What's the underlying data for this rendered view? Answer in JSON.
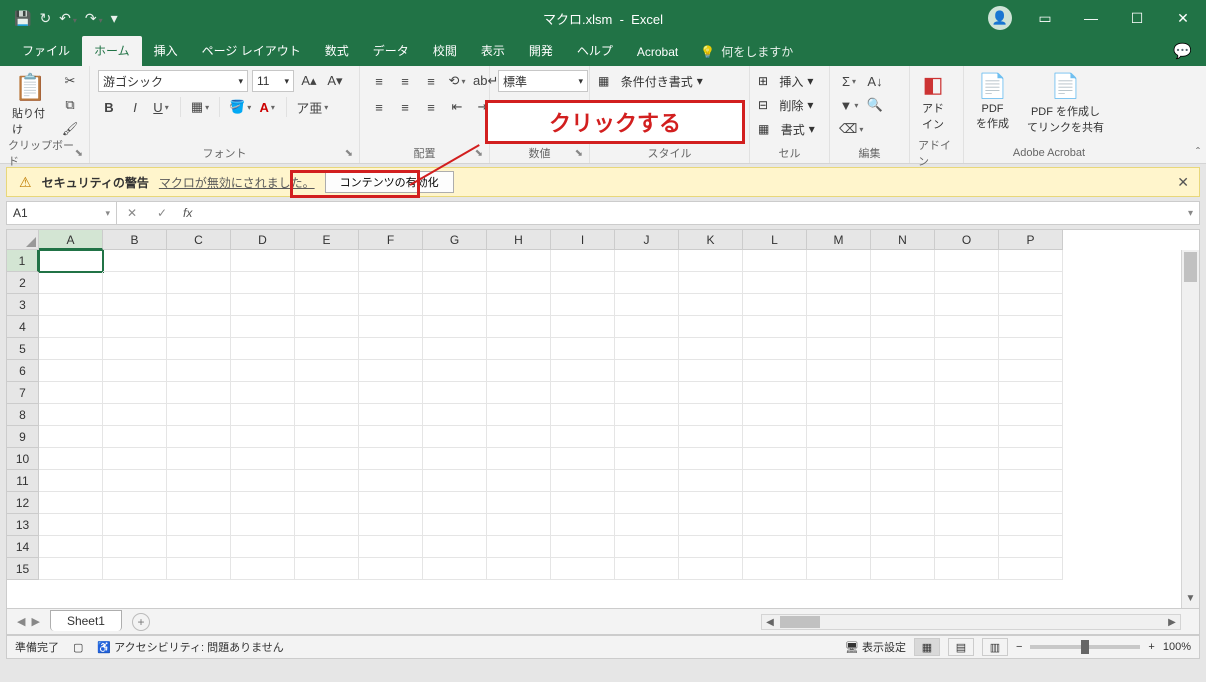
{
  "titlebar": {
    "filename": "マクロ.xlsm",
    "app": "Excel"
  },
  "tabs": {
    "items": [
      "ファイル",
      "ホーム",
      "挿入",
      "ページ レイアウト",
      "数式",
      "データ",
      "校閲",
      "表示",
      "開発",
      "ヘルプ",
      "Acrobat"
    ],
    "active_index": 1,
    "tellme": "何をしますか"
  },
  "ribbon": {
    "clipboard": {
      "paste": "貼り付け",
      "label": "クリップボード"
    },
    "font": {
      "name": "游ゴシック",
      "size": "11",
      "label": "フォント"
    },
    "alignment": {
      "label": "配置"
    },
    "number": {
      "format": "標準",
      "label": "数値"
    },
    "styles": {
      "cond": "条件付き書式",
      "label": "スタイル"
    },
    "cells": {
      "insert": "挿入",
      "delete": "削除",
      "format": "書式",
      "label": "セル"
    },
    "editing": {
      "label": "編集"
    },
    "addin": {
      "btn": "アド\nイン",
      "label": "アドイン"
    },
    "acrobat": {
      "create": "PDF\nを作成",
      "share": "PDF を作成し\nてリンクを共有",
      "label": "Adobe Acrobat"
    }
  },
  "security": {
    "title": "セキュリティの警告",
    "msg": "マクロが無効にされました。",
    "enable": "コンテンツの有効化"
  },
  "annotation": {
    "text": "クリックする"
  },
  "namebox": "A1",
  "columns": [
    "A",
    "B",
    "C",
    "D",
    "E",
    "F",
    "G",
    "H",
    "I",
    "J",
    "K",
    "L",
    "M",
    "N",
    "O",
    "P"
  ],
  "rows": [
    "1",
    "2",
    "3",
    "4",
    "5",
    "6",
    "7",
    "8",
    "9",
    "10",
    "11",
    "12",
    "13",
    "14",
    "15"
  ],
  "sheet": {
    "name": "Sheet1"
  },
  "status": {
    "ready": "準備完了",
    "access": "アクセシビリティ: 問題ありません",
    "display": "表示設定",
    "zoom": "100%"
  }
}
